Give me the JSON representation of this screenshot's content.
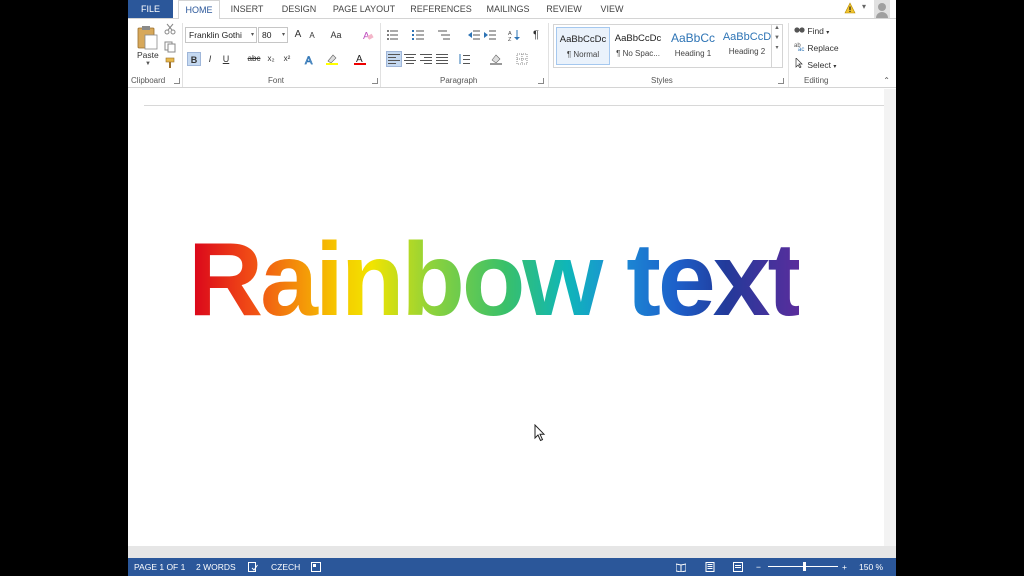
{
  "tabs": [
    "FILE",
    "HOME",
    "INSERT",
    "DESIGN",
    "PAGE LAYOUT",
    "REFERENCES",
    "MAILINGS",
    "REVIEW",
    "VIEW"
  ],
  "clipboard": {
    "paste_label": "Paste",
    "group_label": "Clipboard"
  },
  "font": {
    "name": "Franklin Gothi",
    "size": "80",
    "group_label": "Font",
    "bold": "B",
    "italic": "I",
    "underline": "U",
    "strike": "abc",
    "subscript": "x₂",
    "superscript": "x²",
    "grow": "A",
    "shrink": "A",
    "case": "Aa"
  },
  "paragraph": {
    "group_label": "Paragraph",
    "pilcrow": "¶"
  },
  "styles": {
    "group_label": "Styles",
    "items": [
      {
        "preview": "AaBbCcDc",
        "name": "¶ Normal"
      },
      {
        "preview": "AaBbCcDc",
        "name": "¶ No Spac..."
      },
      {
        "preview": "AaBbCc",
        "name": "Heading 1"
      },
      {
        "preview": "AaBbCcD",
        "name": "Heading 2"
      }
    ]
  },
  "editing": {
    "group_label": "Editing",
    "find": "Find",
    "replace": "Replace",
    "select": "Select"
  },
  "document": {
    "text": "Rainbow text"
  },
  "status": {
    "page": "PAGE 1 OF 1",
    "words": "2 WORDS",
    "language": "CZECH",
    "zoom": "150 %",
    "minus": "−",
    "plus": "+"
  },
  "colors": {
    "accent": "#2b579a",
    "rainbow_start": "#d9001b",
    "rainbow_end": "#5a2d9c"
  }
}
